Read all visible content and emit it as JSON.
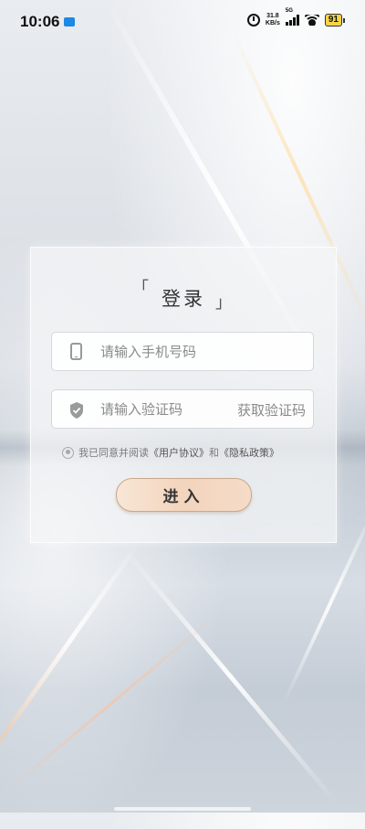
{
  "status_bar": {
    "time": "10:06",
    "net_speed_value": "31.8",
    "net_speed_unit": "KB/s",
    "network_type": "5G",
    "battery_level": "91"
  },
  "login": {
    "title": "登录",
    "bracket_open": "「",
    "bracket_close": "」",
    "phone_placeholder": "请输入手机号码",
    "code_placeholder": "请输入验证码",
    "get_code_label": "获取验证码",
    "agree_prefix": "我已同意并阅读",
    "user_agreement": "《用户协议》",
    "and": "和",
    "privacy_policy": "《隐私政策》",
    "submit_label": "进入"
  },
  "colors": {
    "button_gradient_start": "#f8e6d6",
    "button_gradient_end": "#f3d4bd",
    "battery": "#f5d547"
  }
}
